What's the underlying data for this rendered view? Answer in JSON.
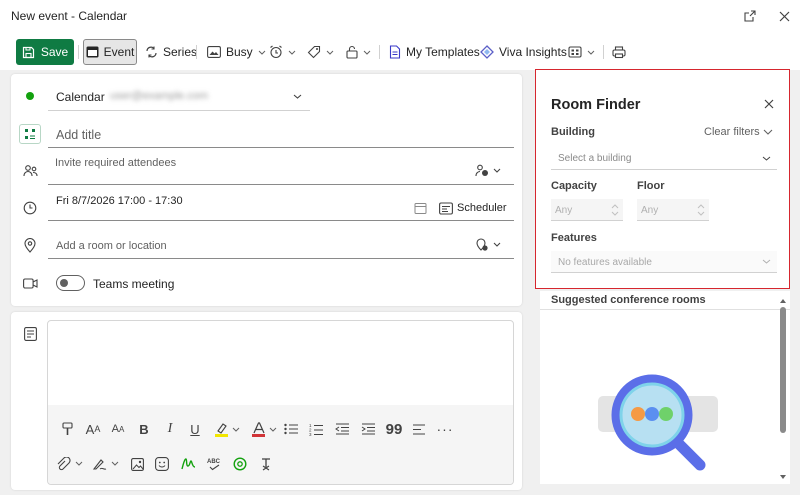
{
  "window": {
    "title": "New event - Calendar"
  },
  "toolbar": {
    "save_label": "Save",
    "event_label": "Event",
    "series_label": "Series",
    "busy_label": "Busy",
    "templates_label": "My Templates",
    "viva_label": "Viva Insights"
  },
  "form": {
    "calendar_label": "Calendar",
    "calendar_account": "user@example.com",
    "title_placeholder": "Add title",
    "attendees_placeholder": "Invite required attendees",
    "datetime": "Fri 8/7/2026 17:00 - 17:30",
    "scheduler_label": "Scheduler",
    "location_placeholder": "Add a room or location",
    "teams_label": "Teams meeting",
    "teams_enabled": false
  },
  "room_finder": {
    "title": "Room Finder",
    "building_label": "Building",
    "clear_filters": "Clear filters",
    "building_placeholder": "Select a building",
    "capacity_label": "Capacity",
    "floor_label": "Floor",
    "capacity_placeholder": "Any",
    "floor_placeholder": "Any",
    "features_label": "Features",
    "features_placeholder": "No features available",
    "suggested_label": "Suggested conference rooms"
  },
  "colors": {
    "accent_green": "#0f7b43",
    "highlight_red": "#d6262e",
    "presence_green": "#13a10e"
  }
}
